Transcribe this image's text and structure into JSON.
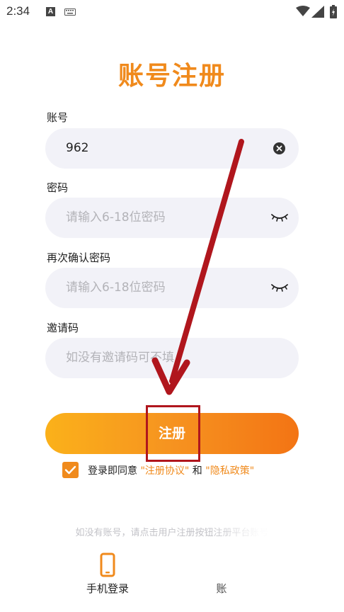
{
  "status_bar": {
    "time": "2:34",
    "a_icon_text": "A",
    "icons": [
      "keyboard-icon",
      "wifi-icon",
      "signal-icon",
      "battery-icon"
    ]
  },
  "title": "账号注册",
  "account": {
    "label": "账号",
    "value": "962"
  },
  "password": {
    "label": "密码",
    "placeholder": "请输入6-18位密码"
  },
  "confirm_password": {
    "label": "再次确认密码",
    "placeholder": "请输入6-18位密码"
  },
  "invite_code": {
    "label": "邀请码",
    "placeholder": "如没有邀请码可不填"
  },
  "register_button": {
    "label": "注册"
  },
  "agreement": {
    "prefix": "登录即同意",
    "terms_link": "\"注册协议\"",
    "conjunction": "和",
    "privacy_link": "\"隐私政策\"",
    "checked": true
  },
  "hint": "如没有账号，请点击用户注册按钮注册平台账号",
  "bottom_tabs": {
    "phone_login": "手机登录",
    "account": "账"
  },
  "colors": {
    "accent": "#f08a1c",
    "button_start": "#fbb11a",
    "button_end": "#f37414",
    "field_bg": "#f2f2f8",
    "annotation": "#b0161d"
  }
}
